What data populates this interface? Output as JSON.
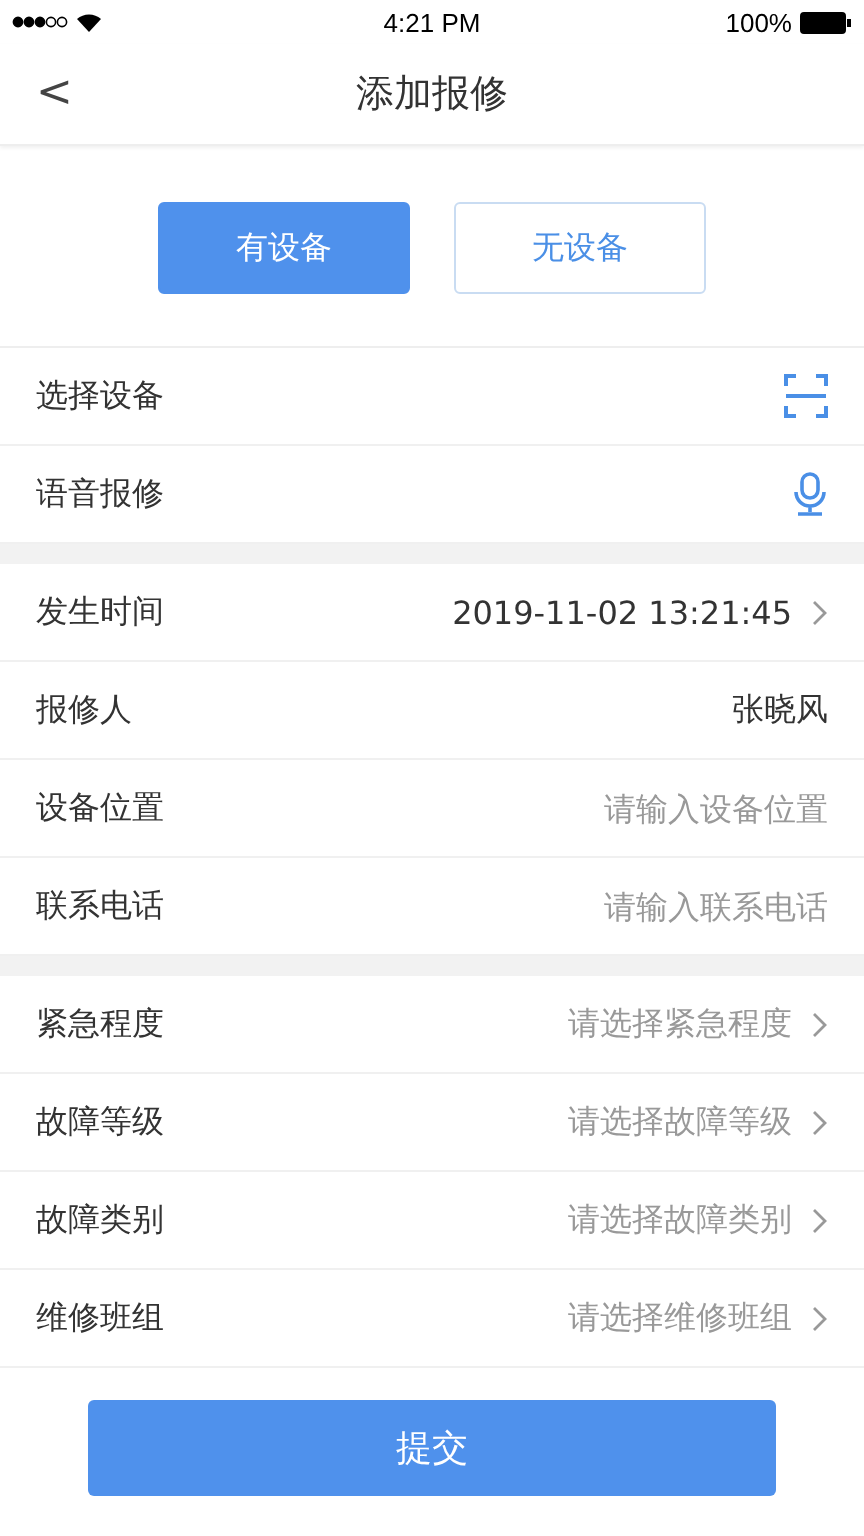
{
  "status_bar": {
    "time": "4:21 PM",
    "battery": "100%"
  },
  "nav": {
    "back": "<",
    "title": "添加报修"
  },
  "segments": [
    {
      "label": "有设备",
      "selected": true
    },
    {
      "label": "无设备",
      "selected": false
    }
  ],
  "sections": [
    {
      "rows": [
        {
          "kind": "scan",
          "label": "选择设备"
        },
        {
          "kind": "voice",
          "label": "语音报修"
        }
      ]
    },
    {
      "rows": [
        {
          "kind": "select",
          "label": "发生时间",
          "value": "2019-11-02 13:21:45"
        },
        {
          "kind": "text",
          "label": "报修人",
          "value": "张晓风"
        },
        {
          "kind": "input",
          "label": "设备位置",
          "placeholder": "请输入设备位置"
        },
        {
          "kind": "input",
          "label": "联系电话",
          "placeholder": "请输入联系电话"
        }
      ]
    },
    {
      "rows": [
        {
          "kind": "select",
          "label": "紧急程度",
          "placeholder": "请选择紧急程度"
        },
        {
          "kind": "select",
          "label": "故障等级",
          "placeholder": "请选择故障等级"
        },
        {
          "kind": "select",
          "label": "故障类别",
          "placeholder": "请选择故障类别"
        },
        {
          "kind": "select",
          "label": "维修班组",
          "placeholder": "请选择维修班组"
        }
      ]
    }
  ],
  "submit": "提交"
}
